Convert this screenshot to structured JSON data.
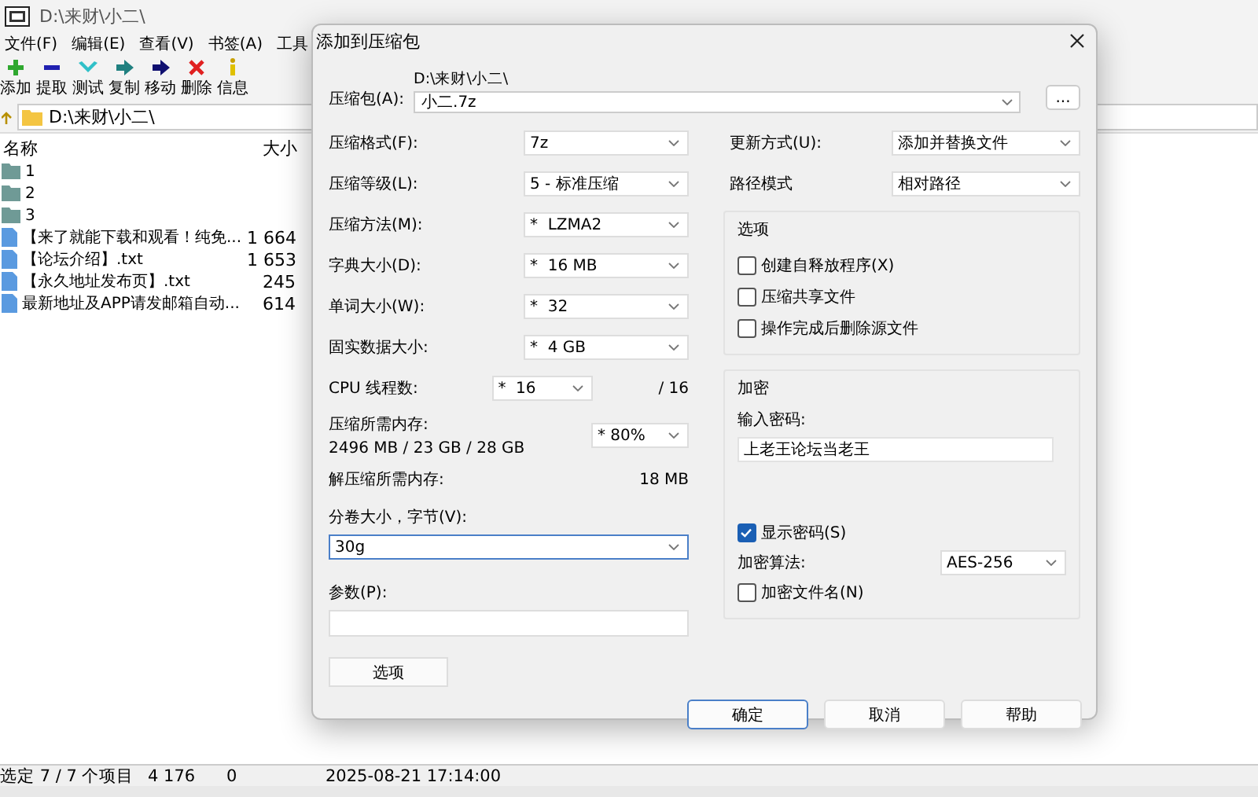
{
  "main_window": {
    "title": "D:\\来财\\小二\\",
    "menu": [
      "文件(F)",
      "编辑(E)",
      "查看(V)",
      "书签(A)",
      "工具"
    ],
    "toolbar": [
      {
        "label": "添加",
        "kind": "add"
      },
      {
        "label": "提取",
        "kind": "extract"
      },
      {
        "label": "测试",
        "kind": "test"
      },
      {
        "label": "复制",
        "kind": "copy"
      },
      {
        "label": "移动",
        "kind": "move"
      },
      {
        "label": "删除",
        "kind": "delete"
      },
      {
        "label": "信息",
        "kind": "info"
      }
    ],
    "address": "D:\\来财\\小二\\",
    "columns": [
      "名称",
      "大小"
    ],
    "rows": [
      {
        "name": "1",
        "kind": "folder"
      },
      {
        "name": "2",
        "kind": "folder"
      },
      {
        "name": "3",
        "kind": "folder"
      },
      {
        "name": "【来了就能下载和观看！纯免...",
        "size": "1 664",
        "kind": "file"
      },
      {
        "name": "【论坛介绍】.txt",
        "size": "1 653",
        "kind": "file"
      },
      {
        "name": "【永久地址发布页】.txt",
        "size": "245",
        "kind": "file"
      },
      {
        "name": "最新地址及APP请发邮箱自动...",
        "size": "614",
        "kind": "file"
      }
    ],
    "status_bar": [
      "选定 7 / 7 个项目",
      "4 176",
      "0",
      "2025-08-21 17:14:00"
    ]
  },
  "dialog": {
    "title": "添加到压缩包",
    "archive": {
      "label": "压缩包(A):",
      "folder": "D:\\来财\\小二\\",
      "value": "小二.7z",
      "browse": "..."
    },
    "left_fields": [
      {
        "kind": "combo",
        "label": "压缩格式(F):",
        "value": "7z"
      },
      {
        "kind": "combo",
        "label": "压缩等级(L):",
        "value": "5 - 标准压缩"
      },
      {
        "kind": "combo",
        "label": "压缩方法(M):",
        "value": "*  LZMA2"
      },
      {
        "kind": "combo",
        "label": "字典大小(D):",
        "value": "*  16 MB"
      },
      {
        "kind": "combo",
        "label": "单词大小(W):",
        "value": "*  32"
      },
      {
        "kind": "combo",
        "label": "固实数据大小:",
        "value": "*  4 GB"
      },
      {
        "kind": "threads",
        "label": "CPU 线程数:",
        "value": "*  16",
        "total": "/ 16"
      },
      {
        "kind": "memory",
        "label": "压缩所需内存:",
        "detail": "2496 MB / 23 GB / 28 GB",
        "value": "* 80%"
      },
      {
        "kind": "readout",
        "label": "解压缩所需内存:",
        "value": "18 MB"
      }
    ],
    "volume": {
      "label": "分卷大小，字节(V):",
      "value": "30g",
      "focused": true
    },
    "params": {
      "label": "参数(P):"
    },
    "options_button": "选项",
    "update_mode": {
      "label": "更新方式(U):",
      "value": "添加并替换文件"
    },
    "path_mode": {
      "label": "路径模式",
      "value": "相对路径"
    },
    "options_group": {
      "title": "选项",
      "checkboxes": [
        {
          "label": "创建自释放程序(X)",
          "checked": false
        },
        {
          "label": "压缩共享文件",
          "checked": false
        },
        {
          "label": "操作完成后删除源文件",
          "checked": false
        }
      ]
    },
    "encryption": {
      "title": "加密",
      "password_label": "输入密码:",
      "password": "上老王论坛当老王",
      "show_password": {
        "label": "显示密码(S)",
        "checked": true
      },
      "method_label": "加密算法:",
      "method": "AES-256",
      "encrypt_names": {
        "label": "加密文件名(N)",
        "checked": false
      }
    },
    "buttons": [
      {
        "label": "确定",
        "default": true
      },
      {
        "label": "取消",
        "default": false
      },
      {
        "label": "帮助",
        "default": false
      }
    ]
  }
}
